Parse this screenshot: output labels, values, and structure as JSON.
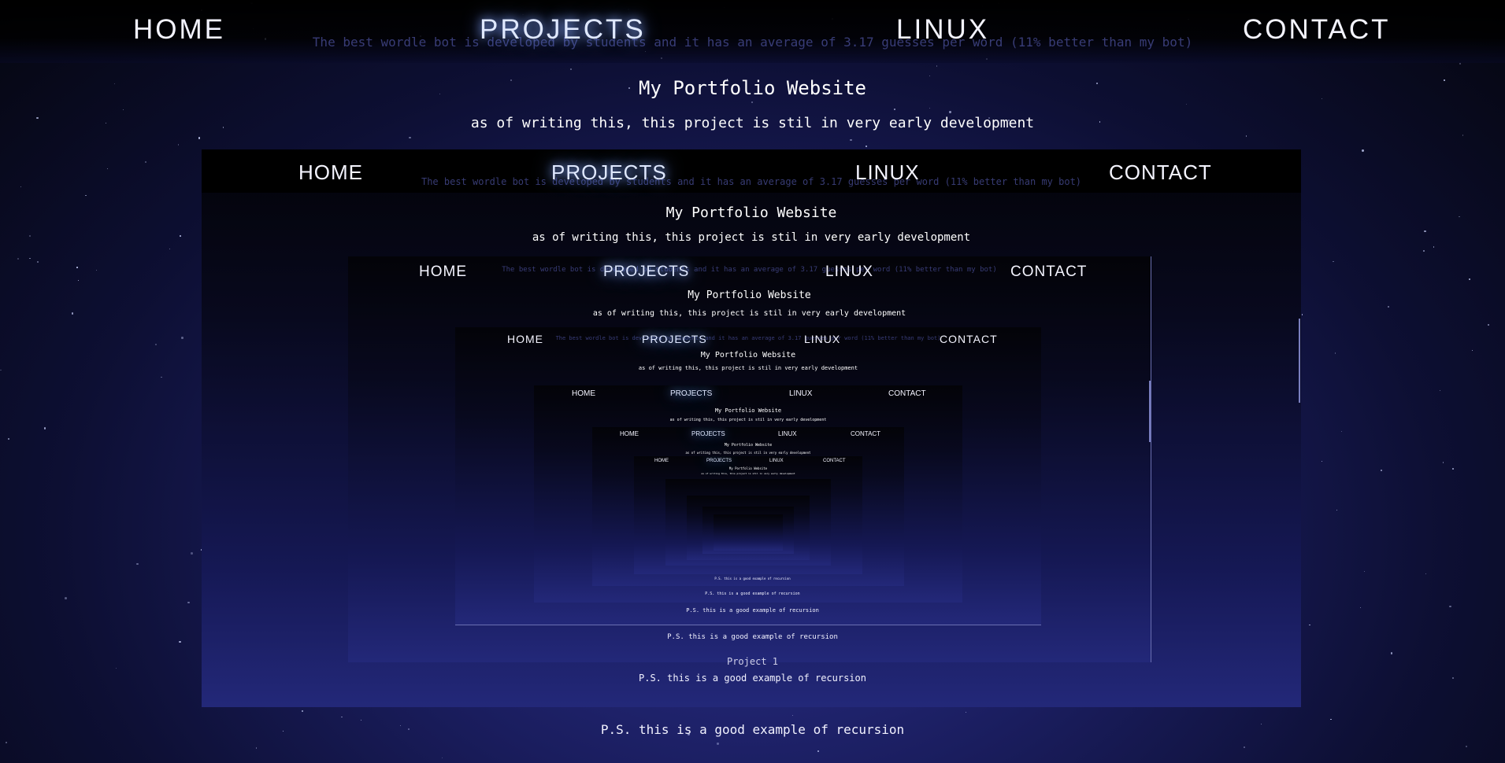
{
  "nav": {
    "home": "HOME",
    "projects": "PROJECTS",
    "linux": "LINUX",
    "contact": "CONTACT"
  },
  "ghost_text": "The best wordle bot is developed by students and it has an average of 3.17 guesses per word (11% better than my bot)",
  "header": {
    "title": "My Portfolio Website",
    "subtitle": "as of writing this, this project is stil in very early development"
  },
  "footer_note": "P.S. this is a good example of recursion",
  "project_heading": "Project 1",
  "colors": {
    "accent_glow": "#8fb0ff",
    "background_deep": "#05060f",
    "background_nebula": "#2a2f8a"
  }
}
